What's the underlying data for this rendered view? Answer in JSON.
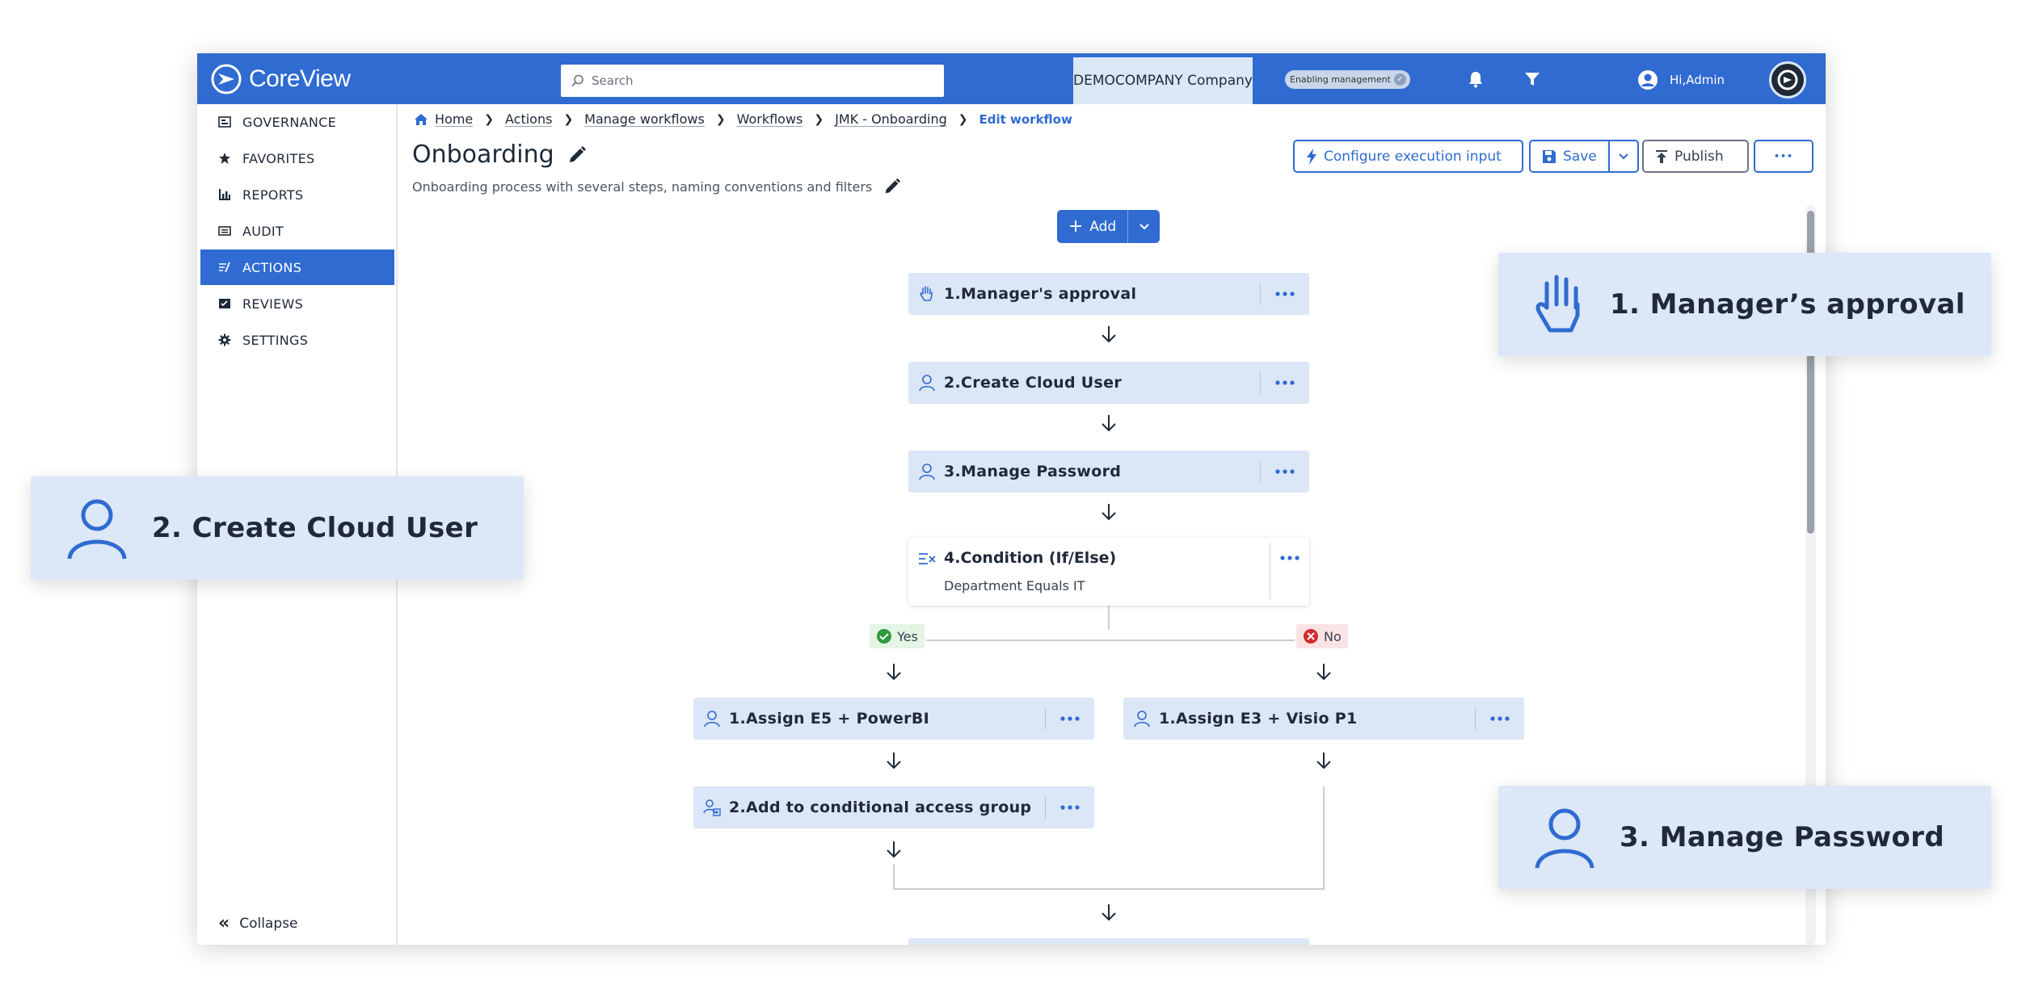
{
  "app": {
    "logo_text": "CoreView",
    "search_placeholder": "Search",
    "company": "DEMOCOMPANY Company",
    "enable_badge": "Enabling management",
    "greeting": "Hi,Admin"
  },
  "sidebar": {
    "items": [
      {
        "label": "GOVERNANCE",
        "icon": "governance-icon"
      },
      {
        "label": "FAVORITES",
        "icon": "star-icon"
      },
      {
        "label": "REPORTS",
        "icon": "bar-chart-icon"
      },
      {
        "label": "AUDIT",
        "icon": "audit-icon"
      },
      {
        "label": "ACTIONS",
        "icon": "actions-icon",
        "active": true
      },
      {
        "label": "REVIEWS",
        "icon": "reviews-icon"
      },
      {
        "label": "SETTINGS",
        "icon": "gear-icon"
      }
    ],
    "collapse_label": "Collapse"
  },
  "breadcrumb": {
    "home": "Home",
    "actions": "Actions",
    "manage_workflows": "Manage workflows",
    "workflows": "Workflows",
    "workflow_name": "JMK - Onboarding",
    "current": "Edit workflow"
  },
  "page": {
    "title": "Onboarding",
    "description": "Onboarding process with several steps, naming conventions and filters"
  },
  "toolbar": {
    "configure_label": "Configure execution input",
    "save_label": "Save",
    "publish_label": "Publish",
    "more_label": "•••",
    "add_label": "Add"
  },
  "flow": {
    "step1": "1.Manager's approval",
    "step2": "2.Create Cloud User",
    "step3": "3.Manage Password",
    "condition_title": "4.Condition (If/Else)",
    "condition_sub": "Department Equals IT",
    "yes_label": "Yes",
    "no_label": "No",
    "yes_step1": "1.Assign E5 + PowerBI",
    "yes_step2": "2.Add to conditional access group",
    "no_step1": "1.Assign E3 + Visio P1"
  },
  "callouts": {
    "c1": "1. Manager’s approval",
    "c2": "2. Create Cloud User",
    "c3": "3. Manage Password"
  },
  "colors": {
    "brand": "#2f6bd1",
    "node_bg": "#dbe6f6",
    "yes": "#2e9a3e",
    "no": "#d12c2c"
  }
}
